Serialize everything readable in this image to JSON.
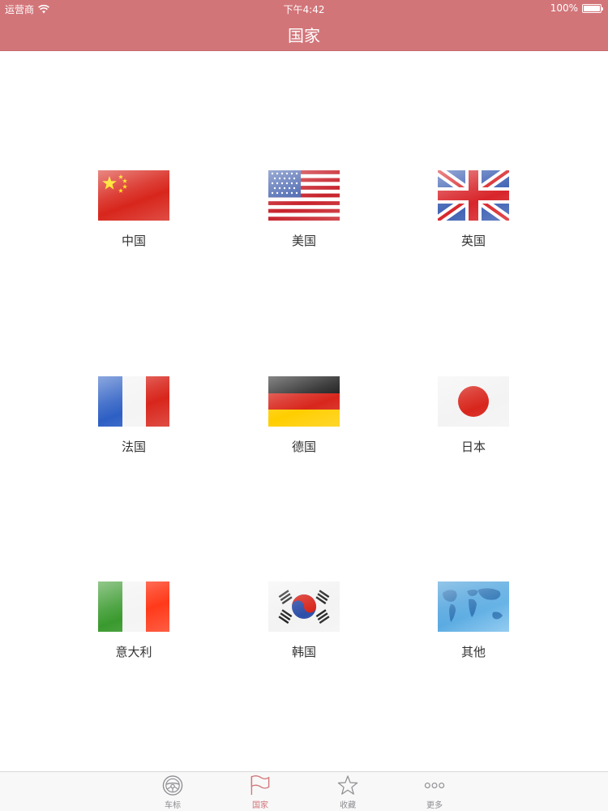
{
  "status_bar": {
    "carrier": "运营商",
    "time": "下午4:42",
    "battery": "100%",
    "battery_level": 1.0
  },
  "nav": {
    "title": "国家"
  },
  "countries": [
    {
      "label": "中国",
      "icon": "china-flag-icon"
    },
    {
      "label": "美国",
      "icon": "usa-flag-icon"
    },
    {
      "label": "英国",
      "icon": "uk-flag-icon"
    },
    {
      "label": "法国",
      "icon": "france-flag-icon"
    },
    {
      "label": "德国",
      "icon": "germany-flag-icon"
    },
    {
      "label": "日本",
      "icon": "japan-flag-icon"
    },
    {
      "label": "意大利",
      "icon": "italy-flag-icon"
    },
    {
      "label": "韩国",
      "icon": "korea-flag-icon"
    },
    {
      "label": "其他",
      "icon": "world-map-icon"
    }
  ],
  "tabs": [
    {
      "label": "车标",
      "icon": "steering-wheel-icon",
      "active": false
    },
    {
      "label": "国家",
      "icon": "flag-icon",
      "active": true
    },
    {
      "label": "收藏",
      "icon": "star-icon",
      "active": false
    },
    {
      "label": "更多",
      "icon": "more-dots-icon",
      "active": false
    }
  ],
  "colors": {
    "accent": "#d27579",
    "tab_inactive": "#8e8e93"
  }
}
